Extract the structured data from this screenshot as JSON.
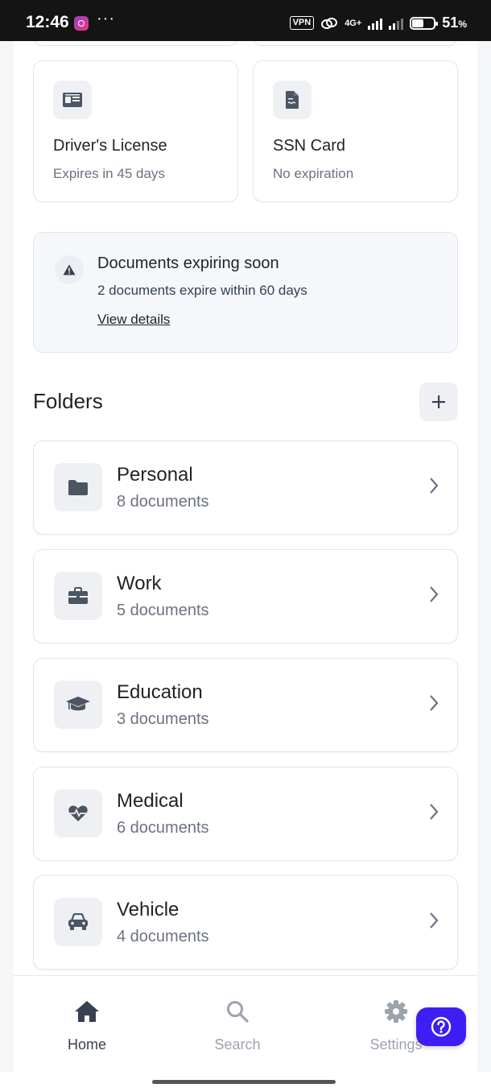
{
  "status_bar": {
    "time": "12:46",
    "dots": "···",
    "vpn": "VPN",
    "network": "4G+",
    "battery_percent": "51",
    "battery_unit": "%"
  },
  "documents": [
    {
      "title": "Driver's License",
      "subtitle": "Expires in 45 days",
      "icon": "id-card-icon"
    },
    {
      "title": "SSN Card",
      "subtitle": "No expiration",
      "icon": "document-icon"
    }
  ],
  "alert": {
    "title": "Documents expiring soon",
    "message": "2 documents expire within 60 days",
    "link": "View details",
    "icon": "warning-icon"
  },
  "folders": {
    "title": "Folders",
    "items": [
      {
        "name": "Personal",
        "count": "8 documents",
        "icon": "folder-icon"
      },
      {
        "name": "Work",
        "count": "5 documents",
        "icon": "briefcase-icon"
      },
      {
        "name": "Education",
        "count": "3 documents",
        "icon": "graduation-cap-icon"
      },
      {
        "name": "Medical",
        "count": "6 documents",
        "icon": "heartbeat-icon"
      },
      {
        "name": "Vehicle",
        "count": "4 documents",
        "icon": "car-icon"
      }
    ]
  },
  "tabbar": {
    "home": "Home",
    "search": "Search",
    "settings": "Settings"
  },
  "colors": {
    "accent": "#3d1ef5",
    "icon": "#4b5563",
    "muted": "#6b7280",
    "active_tab": "#374151",
    "inactive_tab": "#9ca3af"
  }
}
